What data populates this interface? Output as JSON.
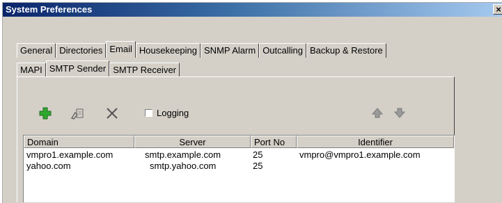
{
  "window": {
    "title": "System Preferences",
    "close_glyph": "×"
  },
  "tabs_row1": [
    {
      "label": "General"
    },
    {
      "label": "Directories"
    },
    {
      "label": "Email"
    },
    {
      "label": "Housekeeping"
    },
    {
      "label": "SNMP Alarm"
    },
    {
      "label": "Outcalling"
    },
    {
      "label": "Backup & Restore"
    }
  ],
  "tabs_row2": [
    {
      "label": "MAPI"
    },
    {
      "label": "SMTP Sender"
    },
    {
      "label": "SMTP Receiver"
    }
  ],
  "toolbar": {
    "logging_label": "Logging",
    "logging_checked": false,
    "add_icon": "plus-icon",
    "edit_icon": "edit-icon",
    "delete_icon": "delete-x-icon",
    "up_icon": "arrow-up-icon",
    "down_icon": "arrow-down-icon",
    "add_color": "#2fa82f"
  },
  "table": {
    "headers": [
      "Domain",
      "Server",
      "Port No",
      "Identifier"
    ],
    "rows": [
      [
        "vmpro1.example.com",
        "smtp.example.com",
        "25",
        "vmpro@vmpro1.example.com"
      ],
      [
        "yahoo.com",
        "smtp.yahoo.com",
        "25",
        ""
      ]
    ]
  }
}
